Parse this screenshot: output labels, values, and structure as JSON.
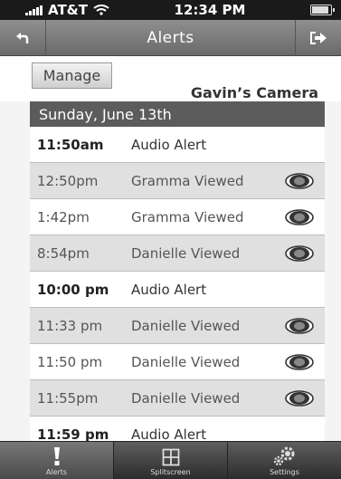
{
  "status": {
    "carrier": "AT&T",
    "time": "12:34 PM"
  },
  "nav": {
    "title": "Alerts",
    "back_icon": "back-arrow-icon",
    "action_icon": "share-icon"
  },
  "header": {
    "manage_label": "Manage",
    "camera_name": "Gavin’s Camera"
  },
  "list": {
    "date_header": "Sunday, June 13th",
    "rows": [
      {
        "time": "11:50am",
        "text": "Audio Alert",
        "bold": true,
        "shade": false,
        "eye": false
      },
      {
        "time": "12:50pm",
        "text": "Gramma Viewed",
        "bold": false,
        "shade": true,
        "eye": true
      },
      {
        "time": "1:42pm",
        "text": "Gramma Viewed",
        "bold": false,
        "shade": false,
        "eye": true
      },
      {
        "time": "8:54pm",
        "text": "Danielle Viewed",
        "bold": false,
        "shade": true,
        "eye": true
      },
      {
        "time": "10:00 pm",
        "text": "Audio Alert",
        "bold": true,
        "shade": false,
        "eye": false
      },
      {
        "time": "11:33 pm",
        "text": "Danielle Viewed",
        "bold": false,
        "shade": true,
        "eye": true
      },
      {
        "time": "11:50 pm",
        "text": "Danielle Viewed",
        "bold": false,
        "shade": false,
        "eye": true
      },
      {
        "time": "11:55pm",
        "text": "Danielle Viewed",
        "bold": false,
        "shade": true,
        "eye": true
      },
      {
        "time": "11:59 pm",
        "text": "Audio Alert",
        "bold": true,
        "shade": false,
        "eye": false
      }
    ]
  },
  "tabs": [
    {
      "label": "Alerts",
      "icon": "exclamation-icon",
      "active": true
    },
    {
      "label": "Splitscreen",
      "icon": "grid-icon",
      "active": false
    },
    {
      "label": "Settings",
      "icon": "gears-icon",
      "active": false
    }
  ]
}
